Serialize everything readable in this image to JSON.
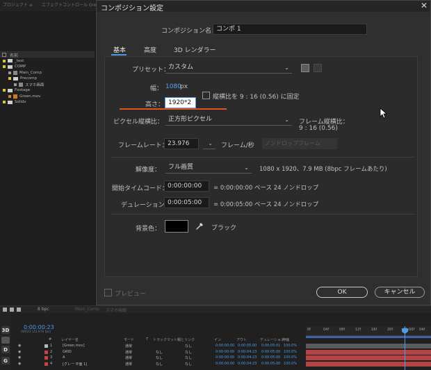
{
  "dialog": {
    "title": "コンポジション設定",
    "close_glyph": "✕",
    "comp_name_label": "コンポジション名：",
    "comp_name_value": "コンポ 1",
    "tabs": [
      "基本",
      "高度",
      "3D レンダラー"
    ],
    "preset_label": "プリセット：",
    "preset_value": "カスタム",
    "width_label": "幅：",
    "width_value": "1080",
    "width_unit": "px",
    "lock_aspect_label": "縦横比を 9 : 16 (0.56) に固定",
    "height_label": "高さ：",
    "height_value": "1920*2",
    "pixel_aspect_label": "ピクセル縦横比：",
    "pixel_aspect_value": "正方形ピクセル",
    "frame_aspect_label": "フレーム縦横比：",
    "frame_aspect_value": "9 : 16 (0.56)",
    "frame_rate_label": "フレームレート：",
    "frame_rate_value": "23.976",
    "frame_rate_unit": "フレーム/秒",
    "drop_frame_button": "ノンドロップフレーム",
    "resolution_label": "解像度：",
    "resolution_value": "フル画質",
    "resolution_info": "1080 x 1920、7.9 MB (8bpc フレームあたり)",
    "start_tc_label": "開始タイムコード：",
    "start_tc_value": "0:00:00:00",
    "start_tc_info": "= 0:00:00:00  ベース 24  ノンドロップ",
    "duration_label": "デュレーション：",
    "duration_value": "0:00:05:00",
    "duration_info": "= 0:00:05:00  ベース 24  ノンドロップ",
    "bg_color_label": "背景色：",
    "bg_color_name": "ブラック",
    "preview_label": "プレビュー",
    "ok_label": "OK",
    "cancel_label": "キャンセル"
  },
  "project": {
    "top_tabs": [
      "プロジェクト ≡",
      "エフェクトコントロール Green.mov"
    ],
    "column_name": "名前",
    "items": [
      {
        "label": "_test",
        "kind": "folder"
      },
      {
        "label": "COMP",
        "kind": "folder"
      },
      {
        "label": "Main_Comp",
        "kind": "comp"
      },
      {
        "label": "Precomp",
        "kind": "folder"
      },
      {
        "label": "スマホ画面",
        "kind": "comp"
      },
      {
        "label": "Footage",
        "kind": "folder"
      },
      {
        "label": "Green.mov",
        "kind": "footage"
      },
      {
        "label": "Solids",
        "kind": "folder"
      }
    ]
  },
  "timeline": {
    "tabs": [
      "Main_Comp",
      "スマホ画面"
    ],
    "panel_label": "8 bpc",
    "side_buttons": [
      "3D",
      "D",
      "G"
    ],
    "timecode": "0:00:00:23",
    "timecode_sub": "00023 (23.976 fps)",
    "columns": [
      "#",
      "レイヤー名",
      "モード",
      "T",
      "トラックマット",
      "親とリンク",
      "イン",
      "アウト",
      "デュレーション",
      "伸縮"
    ],
    "layers": [
      {
        "num": "1",
        "name": "[Green.mov]",
        "mode": "通常",
        "matte": "",
        "parent": "なし",
        "in": "0:00:00:00",
        "out": "0:00:05:00",
        "dur": "0:00:05:01",
        "stretch": "100.0%",
        "color": "#b8b8b8"
      },
      {
        "num": "2",
        "name": "GRID",
        "mode": "通常",
        "matte": "なし",
        "parent": "なし",
        "in": "0:00:00:00",
        "out": "0:00:04:23",
        "dur": "0:00:05:00",
        "stretch": "100.0%",
        "color": "#c74242"
      },
      {
        "num": "3",
        "name": "A",
        "mode": "通常",
        "matte": "なし",
        "parent": "なし",
        "in": "0:00:00:00",
        "out": "0:00:04:23",
        "dur": "0:00:05:00",
        "stretch": "100.0%",
        "color": "#c74242"
      },
      {
        "num": "4",
        "name": "[グレー 平面 1]",
        "mode": "通常",
        "matte": "なし",
        "parent": "なし",
        "in": "0:00:00:00",
        "out": "0:00:04:23",
        "dur": "0:00:05:00",
        "stretch": "100.0%",
        "color": "#c74242"
      }
    ],
    "ruler_ticks": [
      "0f",
      "04f",
      "08f",
      "12f",
      "16f",
      "20f",
      "01:00f",
      "04f"
    ]
  },
  "colors": {
    "accent": "#4f9ae6",
    "highlight": "#e0521f",
    "track_red": "#b54545"
  }
}
